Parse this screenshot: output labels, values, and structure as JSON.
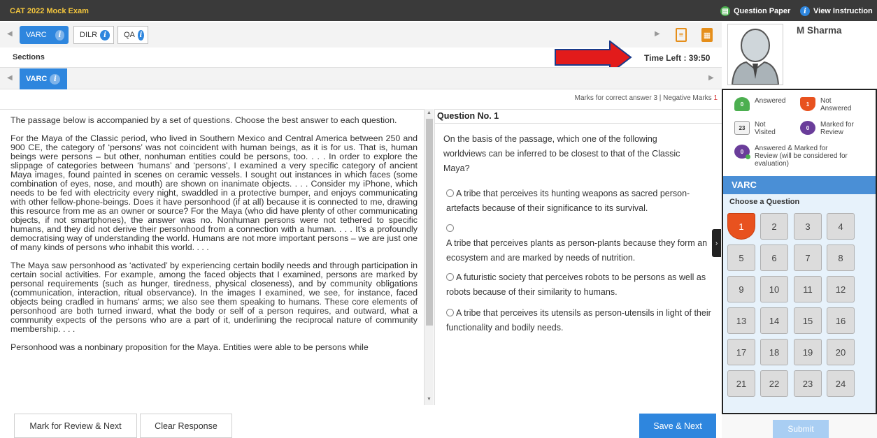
{
  "header": {
    "exam_title": "CAT 2022 Mock Exam",
    "question_paper": "Question Paper",
    "view_instruction": "View Instruction"
  },
  "section_tabs": [
    {
      "label": "VARC",
      "active": true
    },
    {
      "label": "DILR",
      "active": false
    },
    {
      "label": "QA",
      "active": false
    }
  ],
  "sections_label": "Sections",
  "timer": "Time Left : 39:50",
  "sub_tab": "VARC",
  "marks": {
    "prefix": "Marks for correct answer ",
    "correct": "3",
    "separator": " | Negative Marks ",
    "negative": "1"
  },
  "passage": {
    "paragraphs": [
      "The passage below is accompanied by a set of questions. Choose the best answer to each question.",
      "For the Maya of the Classic period, who lived in Southern Mexico and Central America between 250 and 900 CE, the category of ‘persons’ was not coincident with human beings, as it is for us. That is, human beings were persons – but other, nonhuman entities could be persons, too. . . . In order to explore the slippage of categories between ‘humans’ and ‘persons’, I examined a very specific category of ancient Maya images, found painted in scenes on ceramic vessels. I sought out instances in which faces (some combination of eyes, nose, and mouth) are shown on inanimate objects. . . . Consider my iPhone, which needs to be fed with electricity every night, swaddled in a protective bumper, and enjoys communicating with other fellow-phone-beings. Does it have personhood (if at all) because it is connected to me, drawing this resource from me as an owner or source? For the Maya (who did have plenty of other communicating objects, if not smartphones), the answer was no. Nonhuman persons were not tethered to specific humans, and they did not derive their personhood from a connection with a human. . . . It’s a profoundly democratising way of understanding the world. Humans are not more important persons – we are just one of many kinds of persons who inhabit this world. . . .",
      "The Maya saw personhood as ‘activated’ by experiencing certain bodily needs and through participation in certain social activities. For example, among the faced objects that I examined, persons are marked by personal requirements (such as hunger, tiredness, physical closeness), and by community obligations (communication, interaction, ritual observance). In the images I examined, we see, for instance, faced objects being cradled in humans’ arms; we also see them speaking to humans. These core elements of personhood are both turned inward, what the body or self of a person requires, and outward, what a community expects of the persons who are a part of it, underlining the reciprocal nature of community membership. . . .",
      "Personhood was a nonbinary proposition for the Maya. Entities were able to be persons while"
    ]
  },
  "question": {
    "header": "Question No. 1",
    "text": "On the basis of the passage, which one of the following worldviews can be inferred to be closest to that of the Classic Maya?",
    "options": [
      "A tribe that perceives its hunting weapons as sacred person-artefacts because of their significance to its survival.",
      "A tribe that perceives plants as person-plants because they form an ecosystem and are marked by needs of nutrition.",
      "A futuristic society that perceives robots to be persons as well as robots because of their similarity to humans.",
      "A tribe that perceives its utensils as person-utensils in light of their functionality and bodily needs."
    ]
  },
  "buttons": {
    "mark_review": "Mark for Review & Next",
    "clear": "Clear Response",
    "save_next": "Save & Next",
    "submit": "Submit"
  },
  "candidate": {
    "name": "M Sharma"
  },
  "legend": {
    "answered": {
      "count": "0",
      "label": "Answered"
    },
    "not_answered": {
      "count": "1",
      "label": "Not Answered"
    },
    "not_visited": {
      "count": "23",
      "label": "Not Visited"
    },
    "marked": {
      "count": "0",
      "label": "Marked for Review"
    },
    "answered_marked": {
      "count": "0",
      "label": "Answered & Marked for Review (will be considered for evaluation)"
    }
  },
  "palette": {
    "section": "VARC",
    "choose": "Choose a Question",
    "questions": [
      "1",
      "2",
      "3",
      "4",
      "5",
      "6",
      "7",
      "8",
      "9",
      "10",
      "11",
      "12",
      "13",
      "14",
      "15",
      "16",
      "17",
      "18",
      "19",
      "20",
      "21",
      "22",
      "23",
      "24"
    ],
    "current": "1"
  },
  "colors": {
    "accent": "#2e86de",
    "not_answered": "#e8521f",
    "answered": "#4caf50",
    "marked": "#6a3d9a",
    "arrow": "#e21b1b"
  }
}
